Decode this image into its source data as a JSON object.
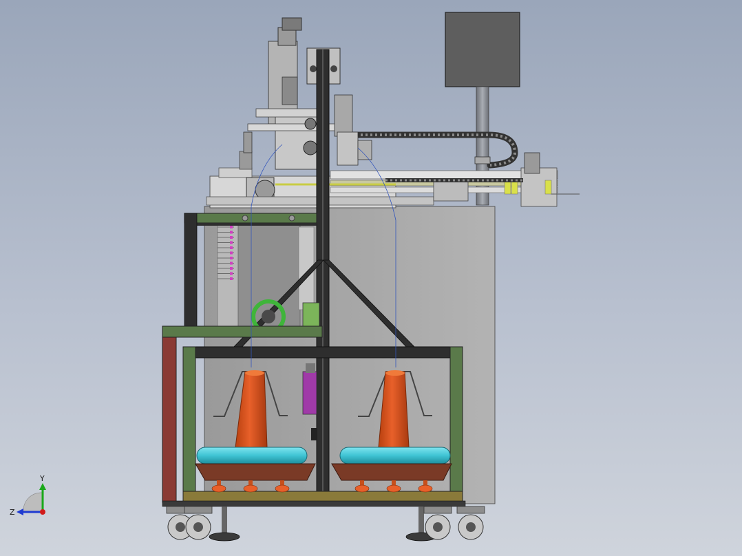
{
  "axis_triad": {
    "y_label": "Y",
    "z_label": "Z",
    "y_color": "#1aa81a",
    "z_color": "#1f3bd1",
    "x_color": "#d11a1a"
  },
  "colors": {
    "background_top": "#9aa6ba",
    "background_bottom": "#cfd4dc",
    "frame_dark": "#2e2e2e",
    "frame_green": "#5a7a4a",
    "frame_red": "#8a3a34",
    "cabinet_grey": "#a6a6a6",
    "control_box": "#5e5e5e",
    "cone_orange": "#d9521c",
    "bobbin_cyan": "#3fc4d4",
    "tray_brown": "#7a3a26",
    "ring_green": "#3fb53a",
    "drive_purple": "#a03aa8",
    "spring_yellow": "#d9e04a",
    "marker_magenta": "#d040c0"
  }
}
